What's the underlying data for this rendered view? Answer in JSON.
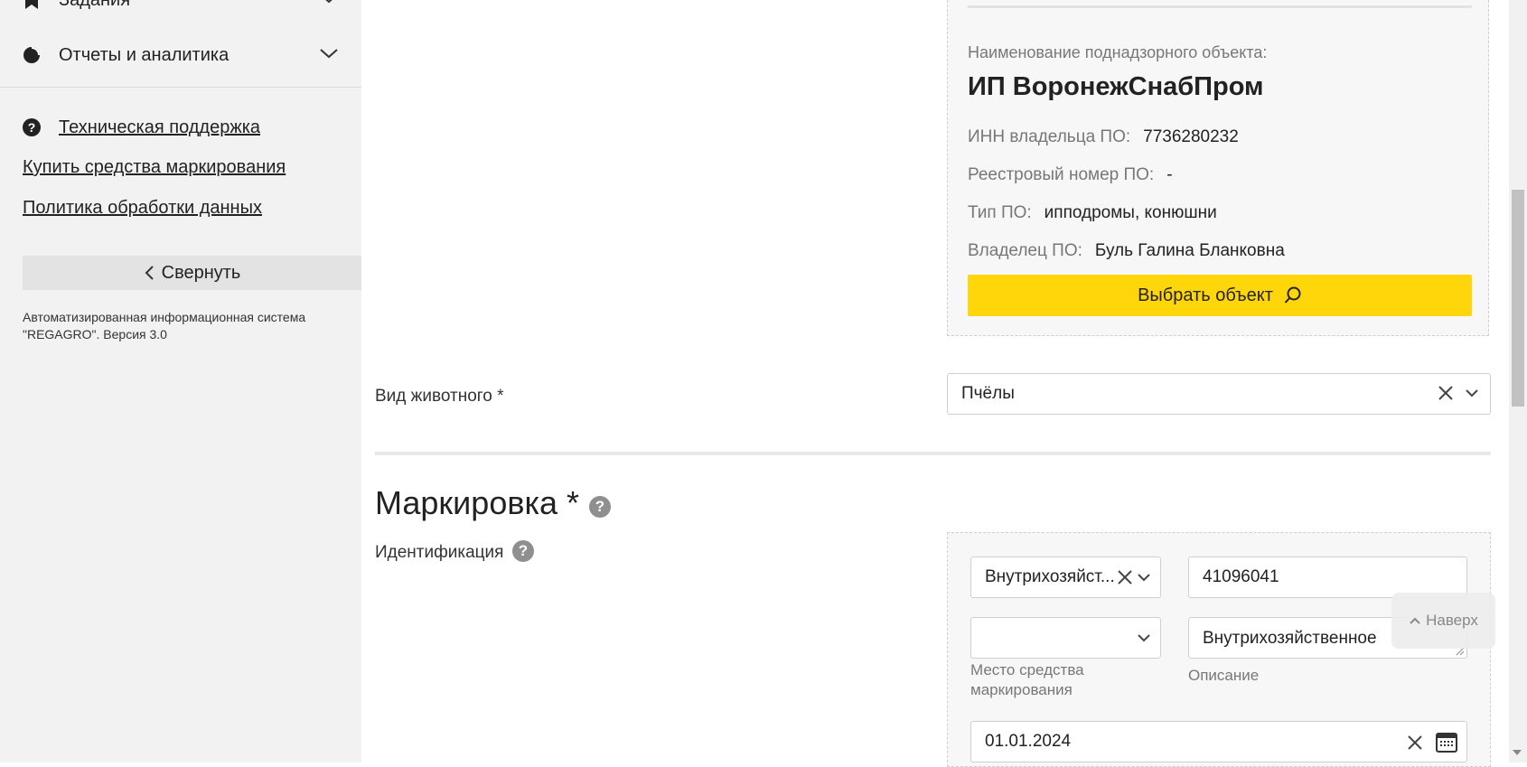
{
  "sidebar": {
    "items": [
      {
        "label": "Задания",
        "icon": "bookmark-icon"
      },
      {
        "label": "Отчеты и аналитика",
        "icon": "pie-chart-icon"
      }
    ],
    "support_label": "Техническая поддержка",
    "buy_label": "Купить средства маркирования",
    "policy_label": "Политика обработки данных",
    "collapse_label": "Свернуть",
    "version_text": "Автоматизированная информационная система \"REGAGRO\". Версия 3.0"
  },
  "object_card": {
    "name_label": "Наименование поднадзорного объекта:",
    "name_value": "ИП ВоронежСнабПром",
    "inn_label": "ИНН владельца ПО:",
    "inn_value": "7736280232",
    "reg_label": "Реестровый номер ПО:",
    "reg_value": "-",
    "type_label": "Тип ПО:",
    "type_value": "ипподромы, конюшни",
    "owner_label": "Владелец ПО:",
    "owner_value": "Буль Галина Бланковна",
    "select_button": "Выбрать объект"
  },
  "animal": {
    "label": "Вид животного *",
    "value": "Пчёлы"
  },
  "marking": {
    "title": "Маркировка *",
    "ident_label": "Идентификация",
    "ident_type_value": "Внутрихозяйст...",
    "number_value": "41096041",
    "place_value": "",
    "place_label": "Место средства маркирования",
    "description_value": "Внутрихозяйственное",
    "description_label": "Описание",
    "date_value": "01.01.2024"
  },
  "to_top_label": "Наверх",
  "colors": {
    "accent": "#ffd60a",
    "sidebar_bg": "#f2f2f2",
    "help_badge": "#8f8f8f"
  }
}
